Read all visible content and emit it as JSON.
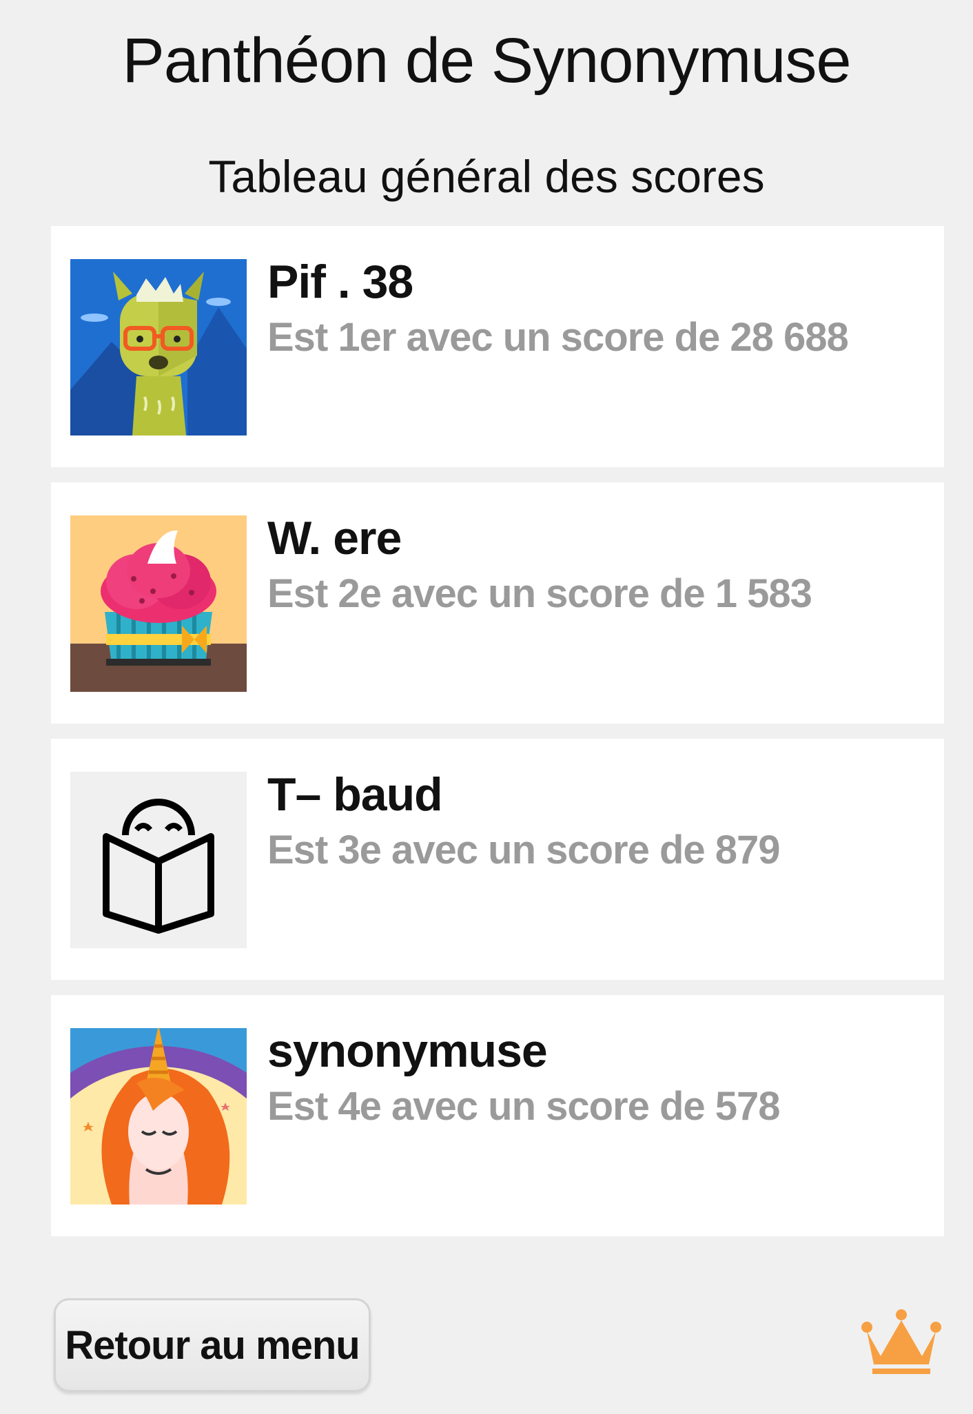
{
  "header": {
    "title": "Panthéon de Synonymuse",
    "subtitle": "Tableau général des scores"
  },
  "leaderboard": [
    {
      "name": "Pif . 38",
      "rank_text": "Est 1er avec un score de 28 688",
      "avatar": "llama-icon"
    },
    {
      "name": "W. ere",
      "rank_text": "Est 2e avec un score de 1 583",
      "avatar": "cupcake-icon"
    },
    {
      "name": "T– baud",
      "rank_text": "Est 3e avec un score de 879",
      "avatar": "book-reader-icon"
    },
    {
      "name": "synonymuse",
      "rank_text": "Est 4e avec un score de 578",
      "avatar": "unicorn-icon"
    }
  ],
  "footer": {
    "back_label": "Retour au menu",
    "crown_icon": "crown-icon",
    "crown_color": "#f7a043"
  }
}
